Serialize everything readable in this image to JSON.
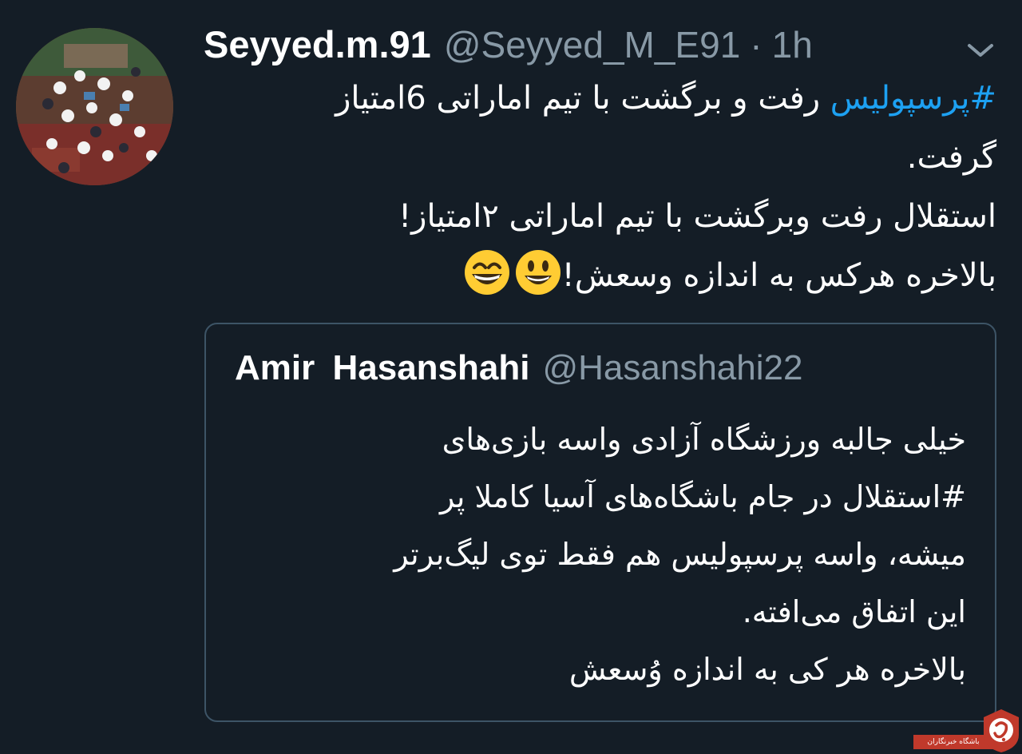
{
  "tweet": {
    "display_name": "Seyyed.m.91",
    "handle": "@Seyyed_M_E91",
    "separator": "·",
    "time": "1h",
    "hashtag": "#پرسپولیس",
    "line1_rest": " رفت و برگشت با تیم اماراتی 6امتیاز",
    "line2": "گرفت.",
    "line3": "استقلال رفت وبرگشت با تیم اماراتی ۲امتیاز!",
    "line4": "بالاخره هرکس به اندازه وسعش!",
    "emojis": [
      "grinning-face-icon",
      "grinning-squinting-face-icon"
    ]
  },
  "quote": {
    "display_name": "Amir  Hasanshahi",
    "handle": "@Hasanshahi22",
    "lines": [
      "خیلی جالبه ورزشگاه آزادی واسه بازی‌های",
      "#استقلال در جام باشگاه‌های آسیا کاملا پر",
      "میشه، واسه پرسپولیس هم فقط توی لیگ‌برتر",
      "این اتفاق می‌افته.",
      "بالاخره هر کی به اندازه وُسعش"
    ]
  },
  "watermark": {
    "label": "باشگاه خبرنگاران"
  },
  "colors": {
    "background": "#141d26",
    "link": "#1da1f2",
    "secondary_text": "#8899a6",
    "border": "#3d5466"
  }
}
